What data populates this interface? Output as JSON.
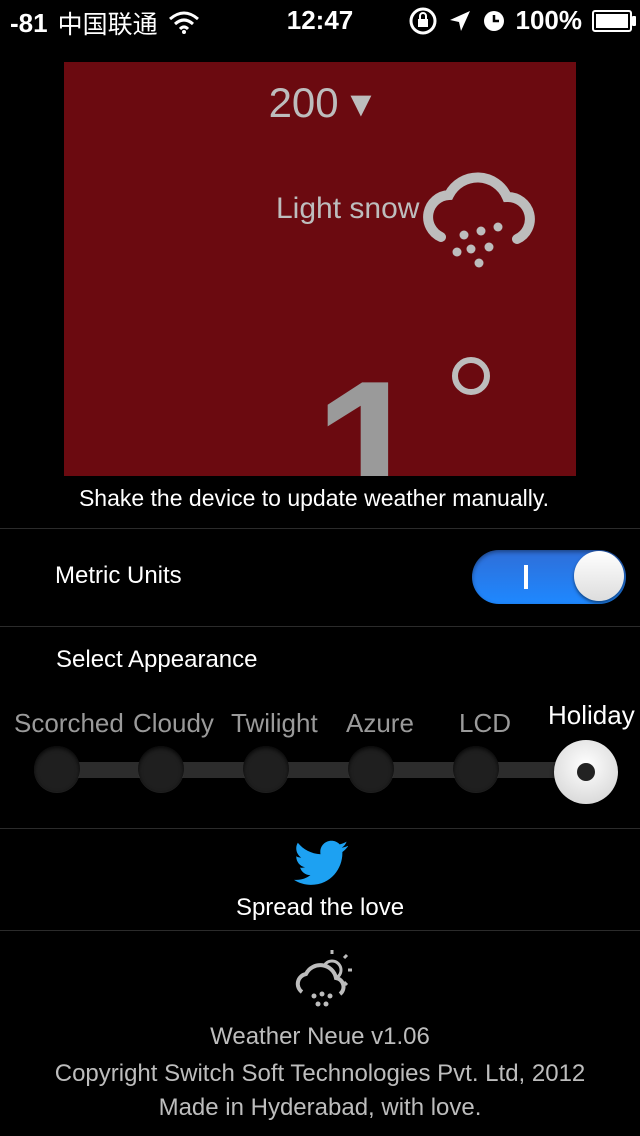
{
  "status_bar": {
    "signal": "-81",
    "carrier": "中国联通",
    "time": "12:47",
    "battery": "100%"
  },
  "preview": {
    "temp_select": "200 ▾",
    "condition": "Light snow",
    "temperature": "1",
    "bg_color": "#6b0a10"
  },
  "shake_hint": "Shake the device to update weather manually.",
  "settings": {
    "metric_units_label": "Metric Units",
    "metric_units_on": true,
    "appearance_label": "Select Appearance",
    "appearances": [
      "Scorched",
      "Cloudy",
      "Twilight",
      "Azure",
      "LCD",
      "Holiday"
    ],
    "selected_appearance": "Holiday"
  },
  "share": {
    "label": "Spread the love",
    "icon": "twitter-bird-icon",
    "accent": "#1da1f2"
  },
  "about": {
    "version": "Weather Neue v1.06",
    "copyright": "Copyright Switch Soft Technologies Pvt. Ltd, 2012",
    "made": "Made in Hyderabad, with love."
  }
}
